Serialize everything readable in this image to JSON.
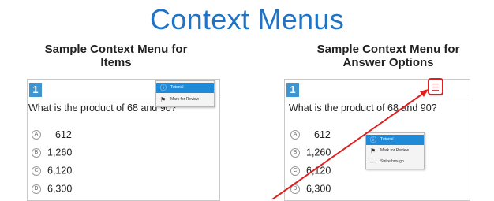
{
  "title": "Context Menus",
  "left": {
    "caption_line1": "Sample Context Menu for",
    "caption_line2": "Items",
    "question": {
      "number": "1",
      "text": "What is the product of 68 and 90?",
      "options": [
        {
          "letter": "A",
          "value": "612"
        },
        {
          "letter": "B",
          "value": "1,260"
        },
        {
          "letter": "C",
          "value": "6,120"
        },
        {
          "letter": "D",
          "value": "6,300"
        }
      ]
    },
    "menu": [
      {
        "label": "Tutorial",
        "icon": "info-icon"
      },
      {
        "label": "Mark for Review",
        "icon": "flag-icon"
      }
    ]
  },
  "right": {
    "caption_line1": "Sample Context Menu for",
    "caption_line2": "Answer Options",
    "question": {
      "number": "1",
      "text": "What is the product of 68 and 90?",
      "options": [
        {
          "letter": "A",
          "value": "612"
        },
        {
          "letter": "B",
          "value": "1,260"
        },
        {
          "letter": "C",
          "value": "6,120"
        },
        {
          "letter": "D",
          "value": "6,300"
        }
      ]
    },
    "menu": [
      {
        "label": "Tutorial",
        "icon": "info-icon"
      },
      {
        "label": "Mark for Review",
        "icon": "flag-icon"
      },
      {
        "label": "Strikethrough",
        "icon": "strikethrough-icon"
      }
    ]
  },
  "colors": {
    "title": "#1f73c4",
    "question_number": "#3f95cf",
    "menu_highlight": "#1f8ad8",
    "annotation_arrow": "#e01e1e"
  }
}
